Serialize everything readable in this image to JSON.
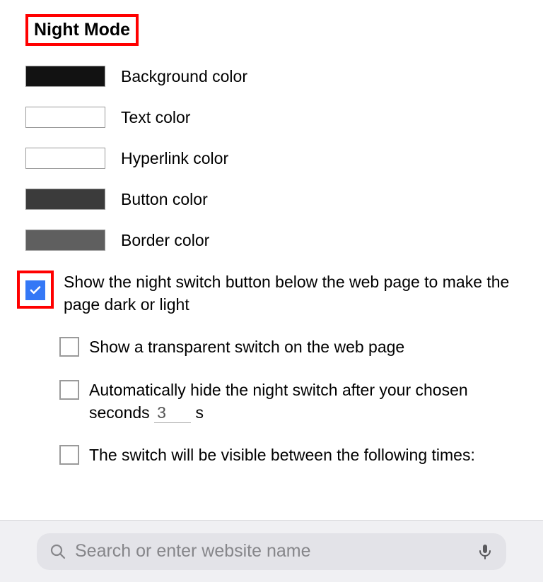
{
  "section": {
    "title": "Night Mode"
  },
  "colors": {
    "background": {
      "label": "Background color",
      "value": "#121212"
    },
    "text": {
      "label": "Text color",
      "value": "#ffffff"
    },
    "hyperlink": {
      "label": "Hyperlink color",
      "value": "#ffffff"
    },
    "button": {
      "label": "Button color",
      "value": "#3b3b3b"
    },
    "border": {
      "label": "Border color",
      "value": "#5f5f5f"
    }
  },
  "options": {
    "showSwitch": {
      "label": "Show the night switch button below the web page to make the page dark or light",
      "checked": true
    },
    "transparentSwitch": {
      "label": "Show a transparent switch on the web page",
      "checked": false
    },
    "autoHide": {
      "label_pre": "Automatically hide the night switch after your chosen seconds",
      "seconds": "3",
      "unit": "s",
      "checked": false
    },
    "visibleTimes": {
      "label": "The switch will be visible between the following times:",
      "checked": false
    }
  },
  "addressbar": {
    "placeholder": "Search or enter website name"
  }
}
